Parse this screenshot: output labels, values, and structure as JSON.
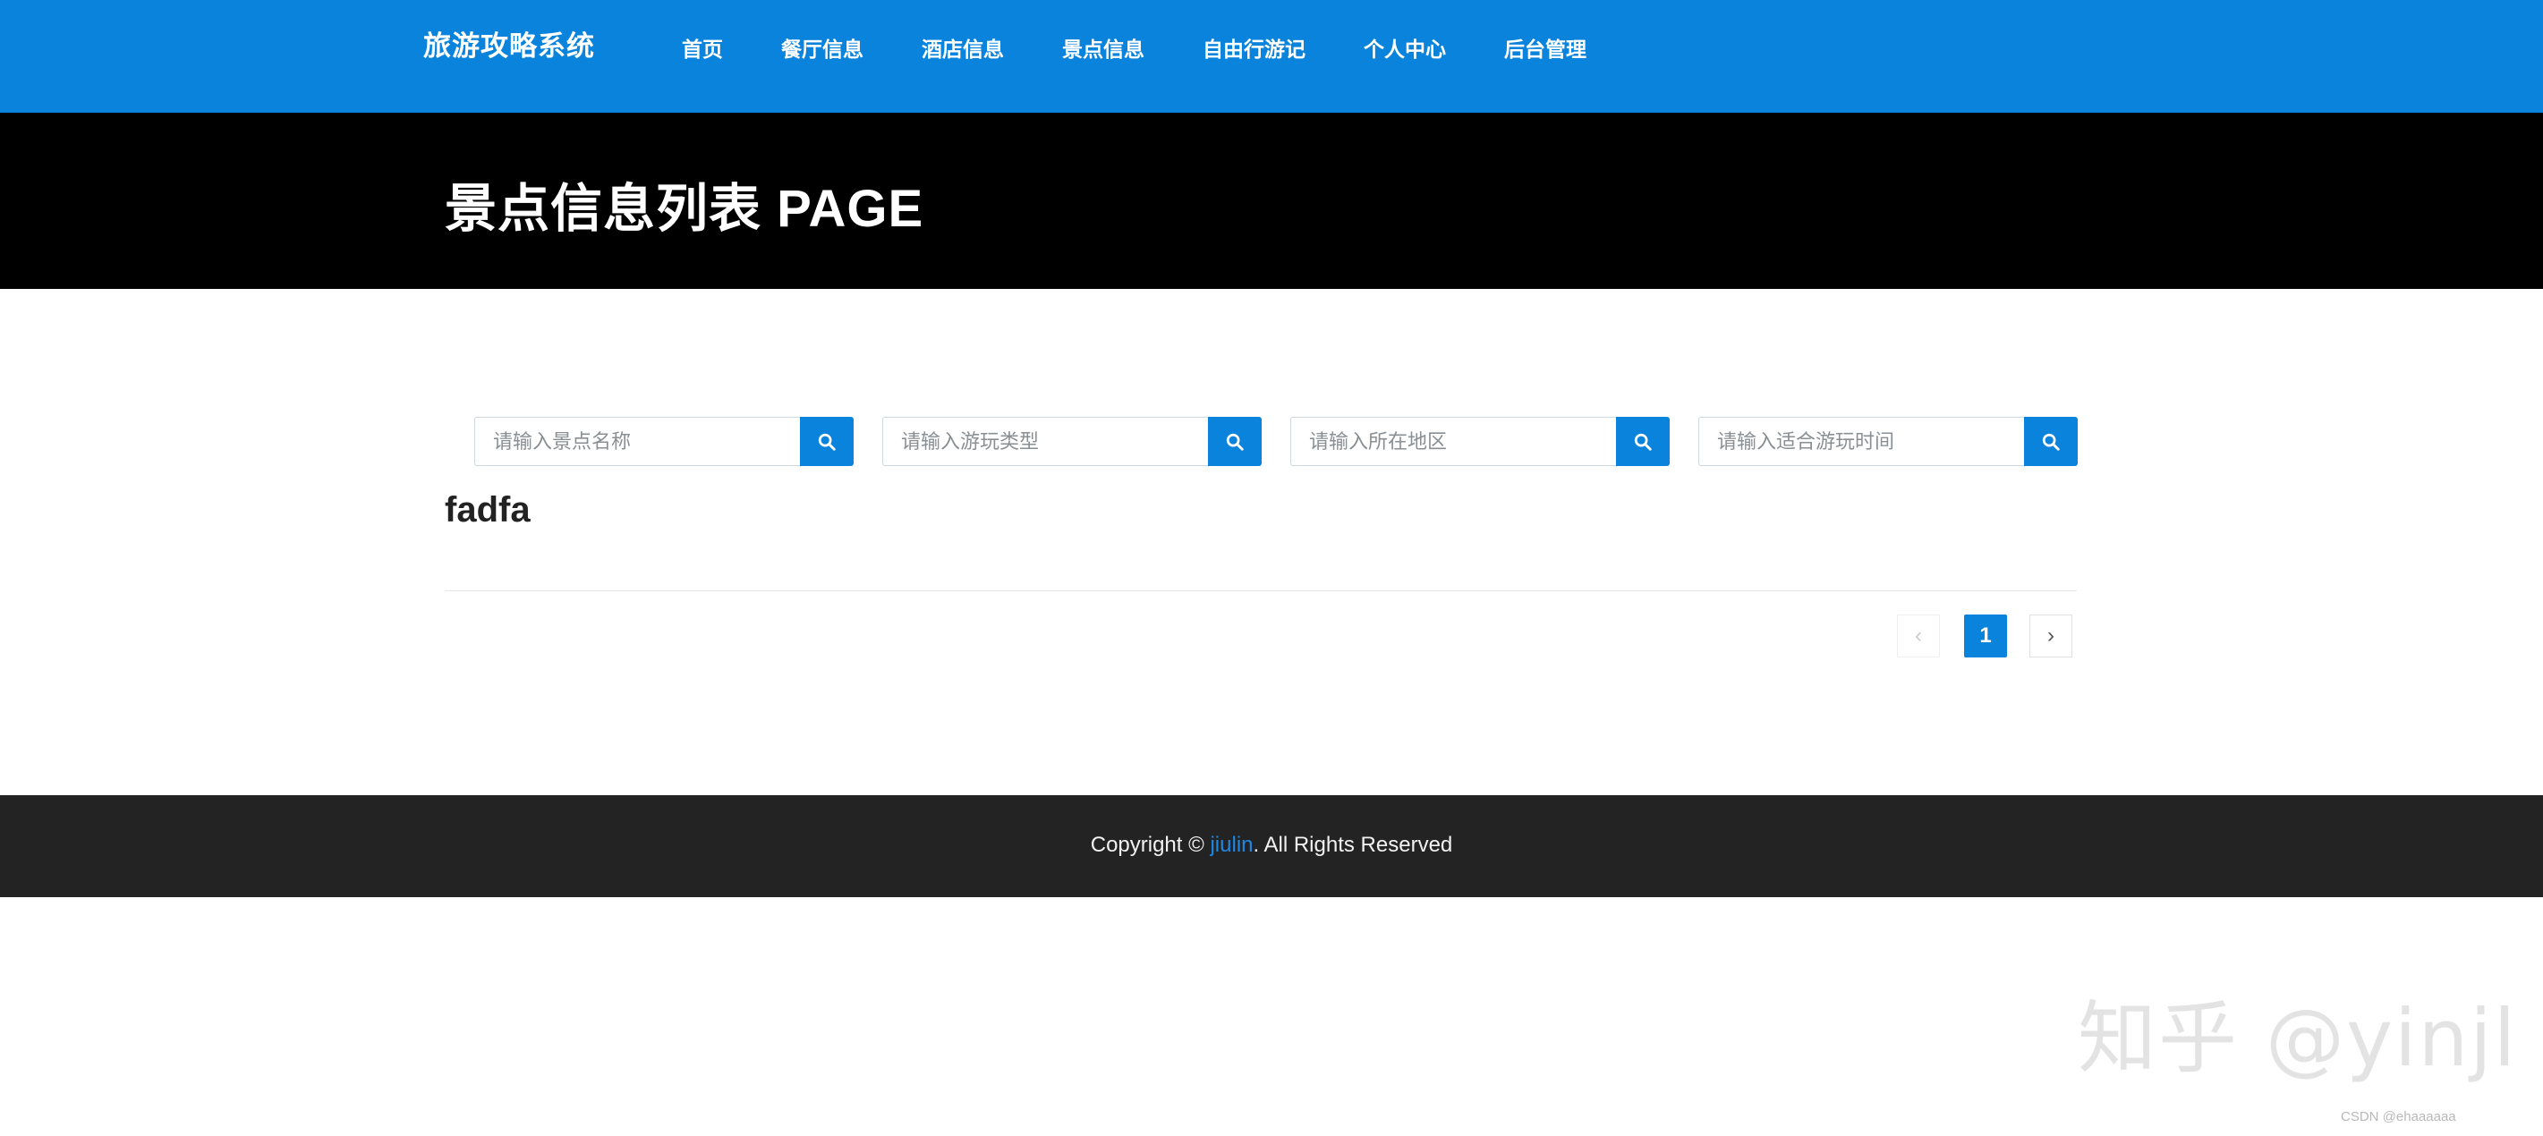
{
  "header": {
    "brand": "旅游攻略系统",
    "nav": [
      "首页",
      "餐厅信息",
      "酒店信息",
      "景点信息",
      "自由行游记",
      "个人中心",
      "后台管理"
    ]
  },
  "banner": {
    "title": "景点信息列表 PAGE"
  },
  "search": {
    "placeholders": [
      "请输入景点名称",
      "请输入游玩类型",
      "请输入所在地区",
      "请输入适合游玩时间"
    ]
  },
  "results": [
    {
      "title": "fadfa"
    }
  ],
  "pagination": {
    "prev": "‹",
    "current": "1",
    "next": "›"
  },
  "footer": {
    "prefix": "Copyright © ",
    "link": "jiulin",
    "suffix": ". All Rights Reserved"
  },
  "watermarks": {
    "zhihu": "知乎 @yinjl",
    "csdn": "CSDN @ehaaaaaa"
  },
  "colors": {
    "primary": "#0a83dd",
    "banner": "#000000",
    "footer": "#232323"
  }
}
